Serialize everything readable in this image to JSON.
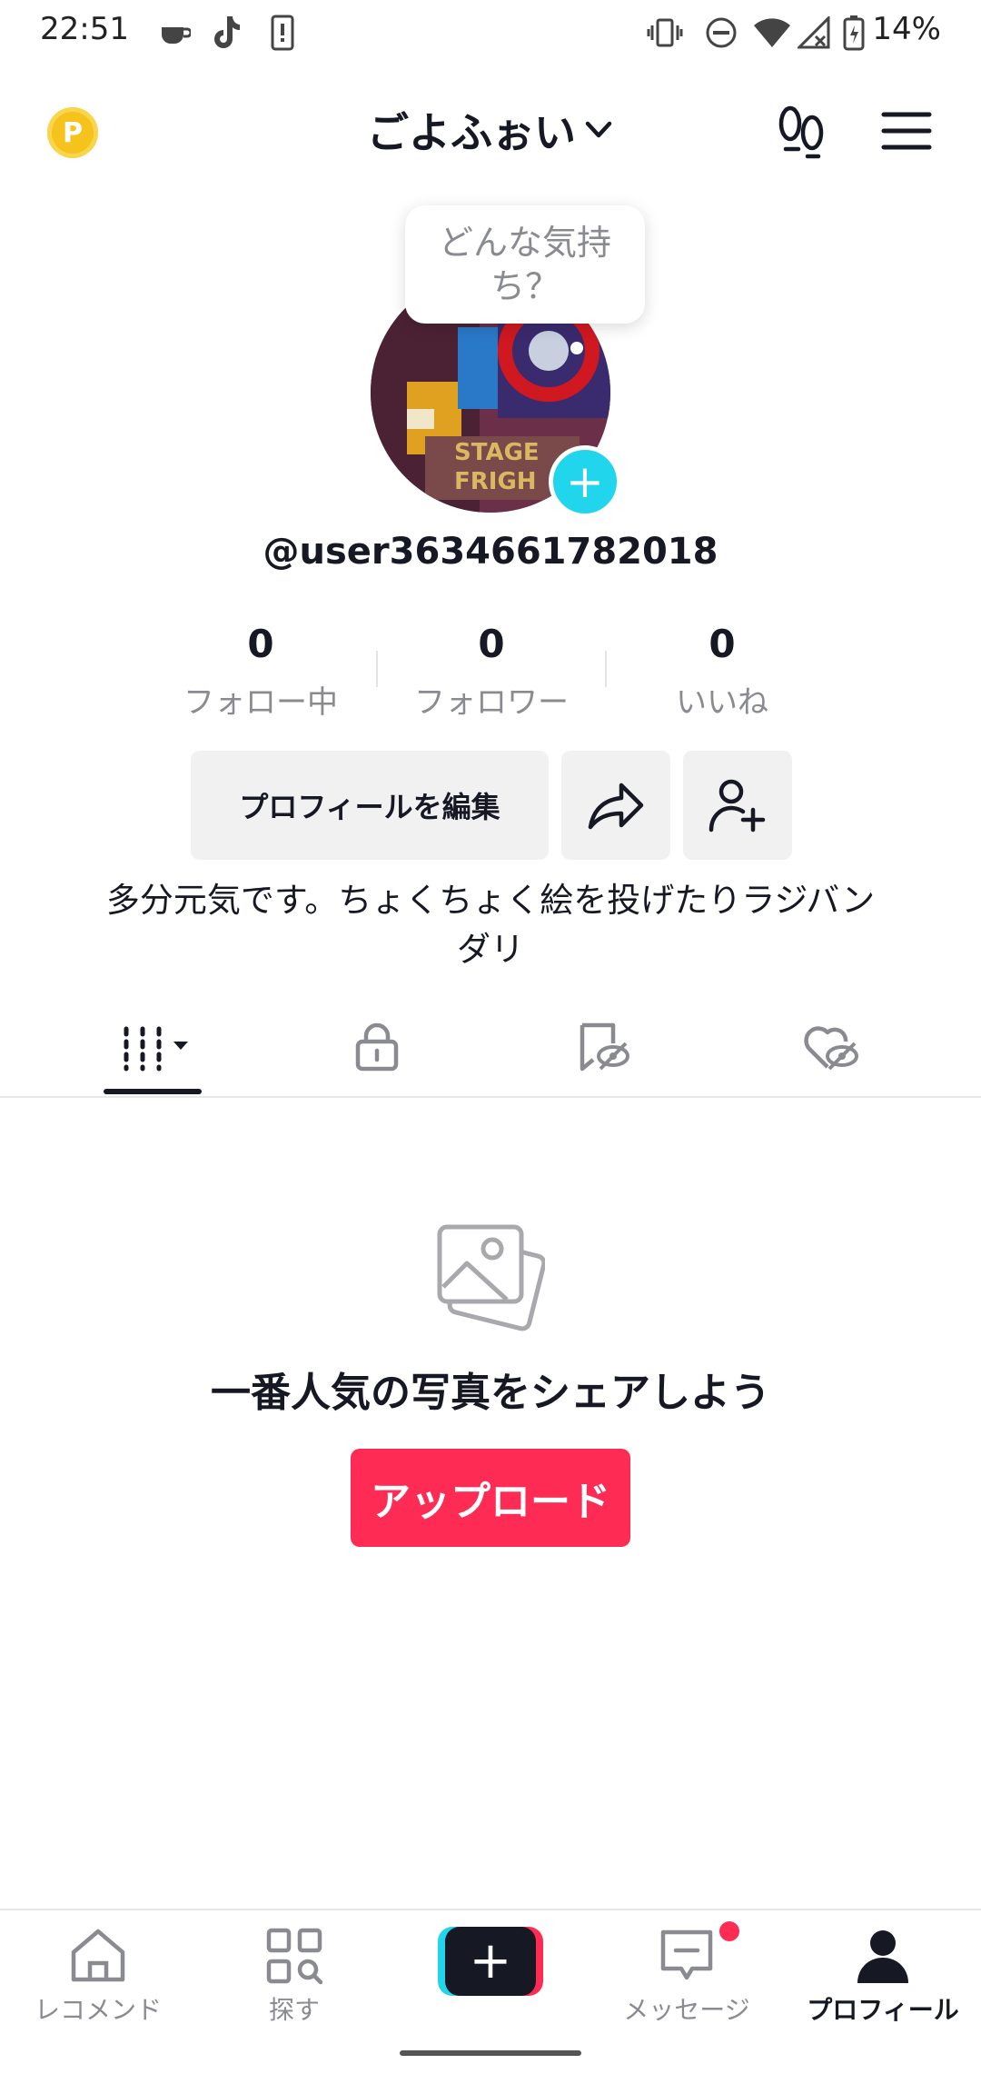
{
  "status_bar": {
    "time": "22:51",
    "battery_percent": "14%"
  },
  "header": {
    "coin_label": "P",
    "title": "ごよふぉい"
  },
  "avatar": {
    "mood_prompt": "どんな気持ち？"
  },
  "profile": {
    "username": "@user3634661782018"
  },
  "stats": [
    {
      "value": "0",
      "label": "フォロー中"
    },
    {
      "value": "0",
      "label": "フォロワー"
    },
    {
      "value": "0",
      "label": "いいね"
    }
  ],
  "actions": {
    "edit_profile": "プロフィールを編集"
  },
  "bio": "多分元気です。ちょくちょく絵を投げたりラジバンダリ",
  "tabs": [
    {
      "icon": "grid-icon"
    },
    {
      "icon": "lock-icon"
    },
    {
      "icon": "hidden-bookmark-icon"
    },
    {
      "icon": "hidden-liked-icon"
    }
  ],
  "empty_state": {
    "message": "一番人気の写真をシェアしよう",
    "upload_button": "アップロード"
  },
  "bottom_nav": [
    {
      "label": "レコメンド",
      "icon": "home-icon"
    },
    {
      "label": "探す",
      "icon": "discover-icon"
    },
    {
      "label": "",
      "icon": "create-plus-icon"
    },
    {
      "label": "メッセージ",
      "icon": "inbox-icon"
    },
    {
      "label": "プロフィール",
      "icon": "profile-icon"
    }
  ],
  "colors": {
    "accent": "#fe2c55",
    "cyan": "#20d5ec",
    "coin": "#f6c21c"
  }
}
